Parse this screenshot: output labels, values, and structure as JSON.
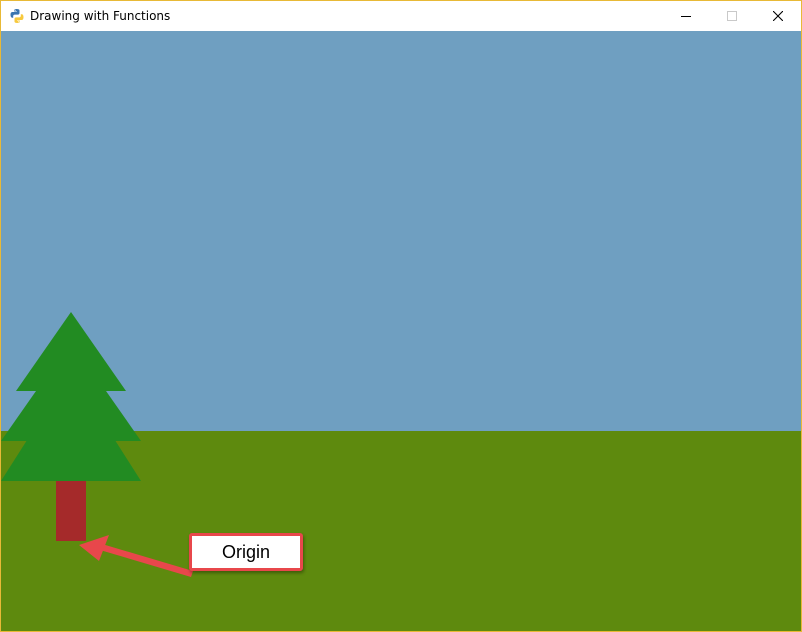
{
  "window": {
    "title": "Drawing with Functions",
    "icon": "python-icon",
    "controls": [
      "minimize-icon",
      "maximize-icon",
      "close-icon"
    ]
  },
  "scene": {
    "sky_color": "#6f9fc1",
    "ground_color": "#5e8a0e",
    "tree_leaf_color": "#228b22",
    "tree_trunk_color": "#a52a2a"
  },
  "annotation": {
    "label": "Origin",
    "accent_color": "#e8474b"
  }
}
